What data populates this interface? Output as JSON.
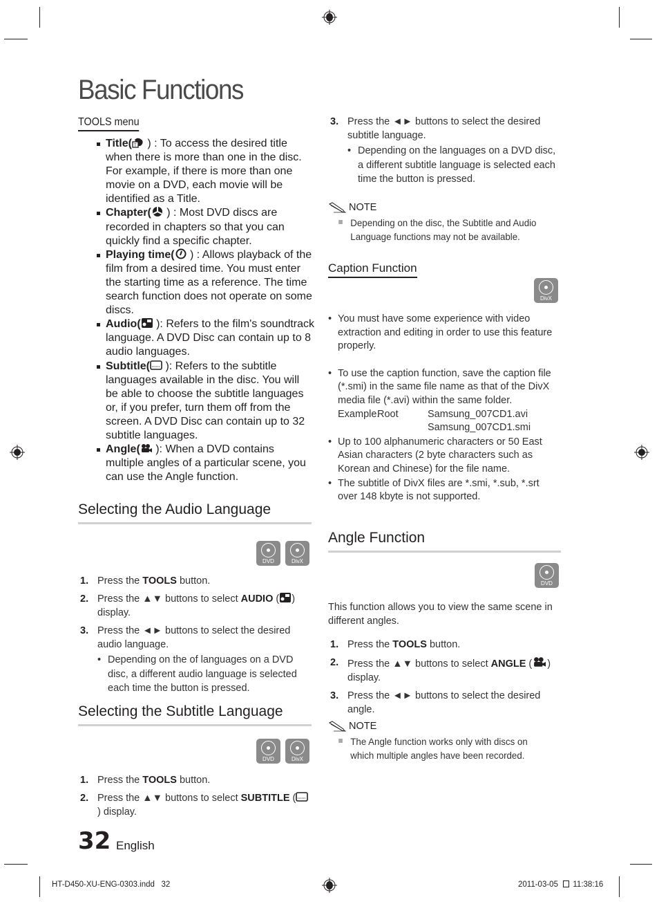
{
  "page": {
    "title": "Basic Functions",
    "number": "32",
    "language": "English"
  },
  "tools_menu": {
    "heading": "TOOLS menu",
    "items": [
      {
        "term": "Title(",
        "icon": "title-icon",
        "close": " ) : To access the desired title when there is more than one in the disc. For example, if there is more than one movie on a DVD, each movie will be identified as a Title."
      },
      {
        "term": "Chapter(",
        "icon": "chapter-icon",
        "close": " ) : Most DVD discs are recorded in chapters so that you can quickly find a specific chapter."
      },
      {
        "term": "Playing time(",
        "icon": "clock-icon",
        "close": " ) : Allows playback of the film from a desired time. You must enter the starting time as a reference. The time search function does not operate on some discs."
      },
      {
        "term": "Audio(",
        "icon": "audio-icon",
        "close": " ): Refers to the film's soundtrack language. A DVD Disc can contain up to 8 audio languages."
      },
      {
        "term": "Subtitle(",
        "icon": "subtitle-icon",
        "close": " ): Refers to the subtitle languages available in the disc. You will be able to choose the subtitle languages or, if you prefer, turn them off from the screen. A DVD Disc can contain up to 32 subtitle languages."
      },
      {
        "term": "Angle(",
        "icon": "angle-icon",
        "close": " ): When a DVD contains multiple angles of a particular scene, you can use the Angle function."
      }
    ]
  },
  "audio_section": {
    "heading": "Selecting the Audio Language",
    "badges": [
      "DVD",
      "DivX"
    ],
    "steps": [
      {
        "num": "1.",
        "pre": "Press the ",
        "bold": "TOOLS",
        "post": " button."
      },
      {
        "num": "2.",
        "pre": "Press the ▲▼ buttons to select ",
        "bold": "AUDIO",
        "post": " display."
      },
      {
        "num": "3.",
        "pre": "Press the ◄► buttons to select the desired audio language.",
        "bold": "",
        "post": ""
      }
    ],
    "sub_bullet": "Depending on the of languages on a DVD disc, a different audio language is selected each time the button is pressed."
  },
  "subtitle_section": {
    "heading": "Selecting the Subtitle Language",
    "badges": [
      "DVD",
      "DivX"
    ],
    "steps": [
      {
        "num": "1.",
        "pre": "Press the ",
        "bold": "TOOLS",
        "post": " button."
      },
      {
        "num": "2.",
        "pre": "Press the ▲▼ buttons to select ",
        "bold": "SUBTITLE",
        "post": " display."
      },
      {
        "num": "3.",
        "pre": "Press the ◄► buttons to select the desired subtitle language.",
        "bold": "",
        "post": ""
      }
    ],
    "sub_bullet": "Depending on the languages on a DVD disc, a different subtitle language is selected each time the button is pressed.",
    "note_title": "NOTE",
    "note": "Depending on the disc, the Subtitle and Audio Language functions may not be available."
  },
  "caption_section": {
    "heading": "Caption Function",
    "badge": "DivX",
    "bullets": [
      "You must have some experience with video extraction and editing in order to use this feature properly.",
      "To use the caption function, save the caption file (*.smi) in the same file name as that of the DivX media file (*.avi) within the same folder.",
      "Up to 100 alphanumeric characters or 50 East Asian characters (2 byte characters such as Korean and Chinese) for the file name.",
      "The subtitle of DivX files are *.smi, *.sub, *.srt over 148 kbyte is not supported."
    ],
    "example": {
      "label": "Example.",
      "folder": "Root",
      "files": [
        "Samsung_007CD1.avi",
        "Samsung_007CD1.smi"
      ]
    }
  },
  "angle_section": {
    "heading": "Angle Function",
    "badge": "DVD",
    "intro": "This function allows you to view the same scene in different angles.",
    "steps": [
      {
        "num": "1.",
        "pre": "Press the ",
        "bold": "TOOLS",
        "post": " button."
      },
      {
        "num": "2.",
        "pre": "Press the ▲▼ buttons to select ",
        "bold": "ANGLE",
        "post": " display."
      },
      {
        "num": "3.",
        "pre": "Press the ◄► buttons to select the desired angle.",
        "bold": "",
        "post": ""
      }
    ],
    "note_title": "NOTE",
    "note": "The Angle function works only with discs on which multiple angles have been recorded."
  },
  "slug": {
    "file": "HT-D450-XU-ENG-0303.indd   32",
    "date": "2011-03-05",
    "time": "11:38:16"
  },
  "colors": {
    "text": "#231f20",
    "badge": "#8a8a8a",
    "rule": "#d0d0d0"
  }
}
